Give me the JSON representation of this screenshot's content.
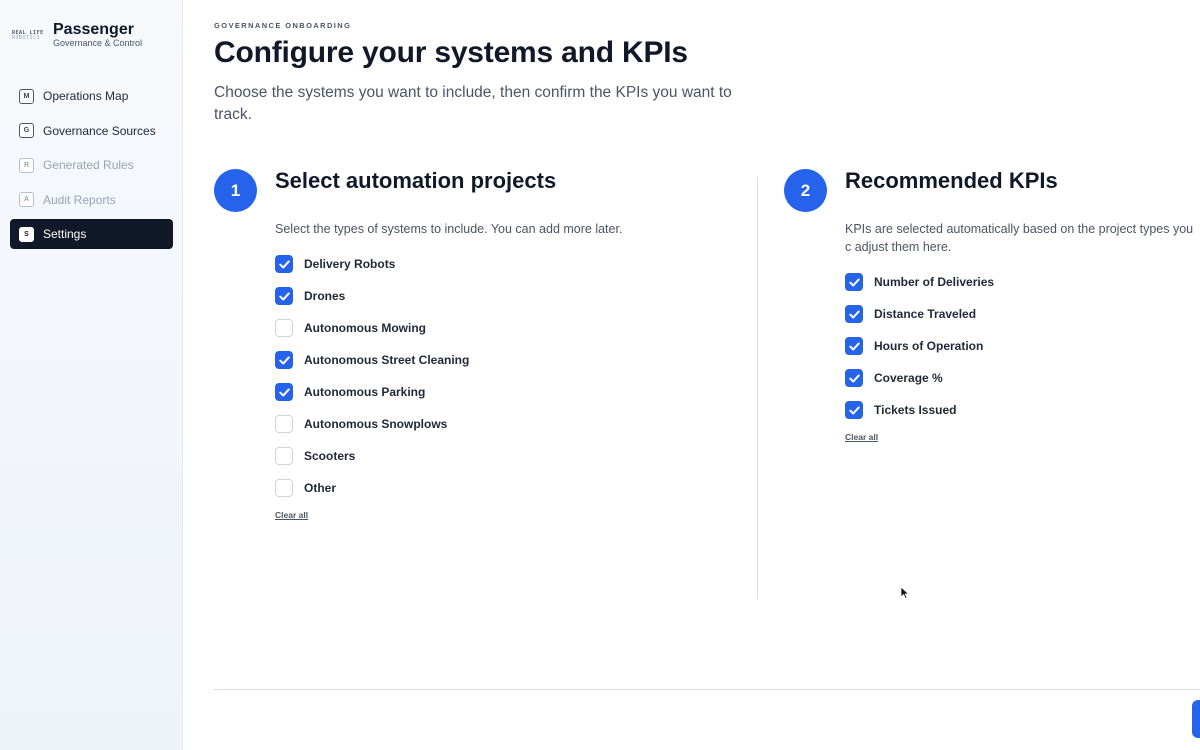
{
  "sidebar": {
    "logo_lines": [
      "REAL LIFE",
      "ROBOTICS"
    ],
    "app_title": "Passenger",
    "app_subtitle": "Governance & Control",
    "items": [
      {
        "badge": "M",
        "label": "Operations Map",
        "state": "normal"
      },
      {
        "badge": "G",
        "label": "Governance Sources",
        "state": "normal"
      },
      {
        "badge": "R",
        "label": "Generated Rules",
        "state": "disabled"
      },
      {
        "badge": "A",
        "label": "Audit Reports",
        "state": "disabled"
      },
      {
        "badge": "S",
        "label": "Settings",
        "state": "active"
      }
    ]
  },
  "main": {
    "eyebrow": "GOVERNANCE ONBOARDING",
    "title": "Configure your systems and KPIs",
    "description": "Choose the systems you want to include, then confirm the KPIs you want to track.",
    "step1": {
      "number": "1",
      "title": "Select automation projects",
      "description": "Select the types of systems to include. You can add more later.",
      "options": [
        {
          "label": "Delivery Robots",
          "checked": true
        },
        {
          "label": "Drones",
          "checked": true
        },
        {
          "label": "Autonomous Mowing",
          "checked": false
        },
        {
          "label": "Autonomous Street Cleaning",
          "checked": true
        },
        {
          "label": "Autonomous Parking",
          "checked": true
        },
        {
          "label": "Autonomous Snowplows",
          "checked": false
        },
        {
          "label": "Scooters",
          "checked": false
        },
        {
          "label": "Other",
          "checked": false
        }
      ],
      "clear_all": "Clear all"
    },
    "step2": {
      "number": "2",
      "title": "Recommended KPIs",
      "description": "KPIs are selected automatically based on the project types you c adjust them here.",
      "options": [
        {
          "label": "Number of Deliveries",
          "checked": true
        },
        {
          "label": "Distance Traveled",
          "checked": true
        },
        {
          "label": "Hours of Operation",
          "checked": true
        },
        {
          "label": "Coverage %",
          "checked": true
        },
        {
          "label": "Tickets Issued",
          "checked": true
        }
      ],
      "clear_all": "Clear all"
    }
  },
  "colors": {
    "accent": "#2563eb",
    "active_nav": "#111827",
    "muted_text": "#4b5563"
  }
}
